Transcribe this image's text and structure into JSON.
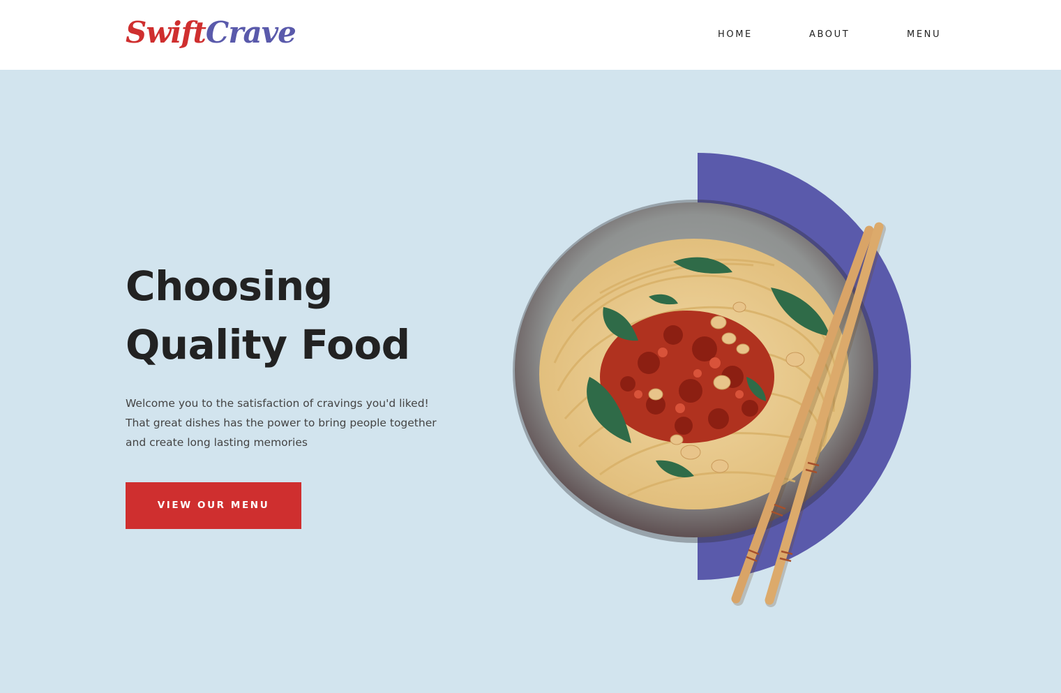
{
  "brand": {
    "logo_part1": "Swift",
    "logo_part2": "Crave",
    "colors": {
      "red": "#cf2f2f",
      "indigo": "#5a5aab",
      "background": "#d2e4ee"
    }
  },
  "nav": {
    "items": [
      {
        "label": "HOME"
      },
      {
        "label": "ABOUT"
      },
      {
        "label": "MENU"
      }
    ]
  },
  "hero": {
    "title_line1": "Choosing",
    "title_line2": "Quality Food",
    "text_line1": "Welcome you to the satisfaction of cravings you'd liked!",
    "text_line2": "That great dishes has the power to bring people together",
    "text_line3": "and create long lasting memories",
    "cta_label": "VIEW OUR MENU",
    "image_icon": "noodle-bowl-with-chopsticks"
  }
}
